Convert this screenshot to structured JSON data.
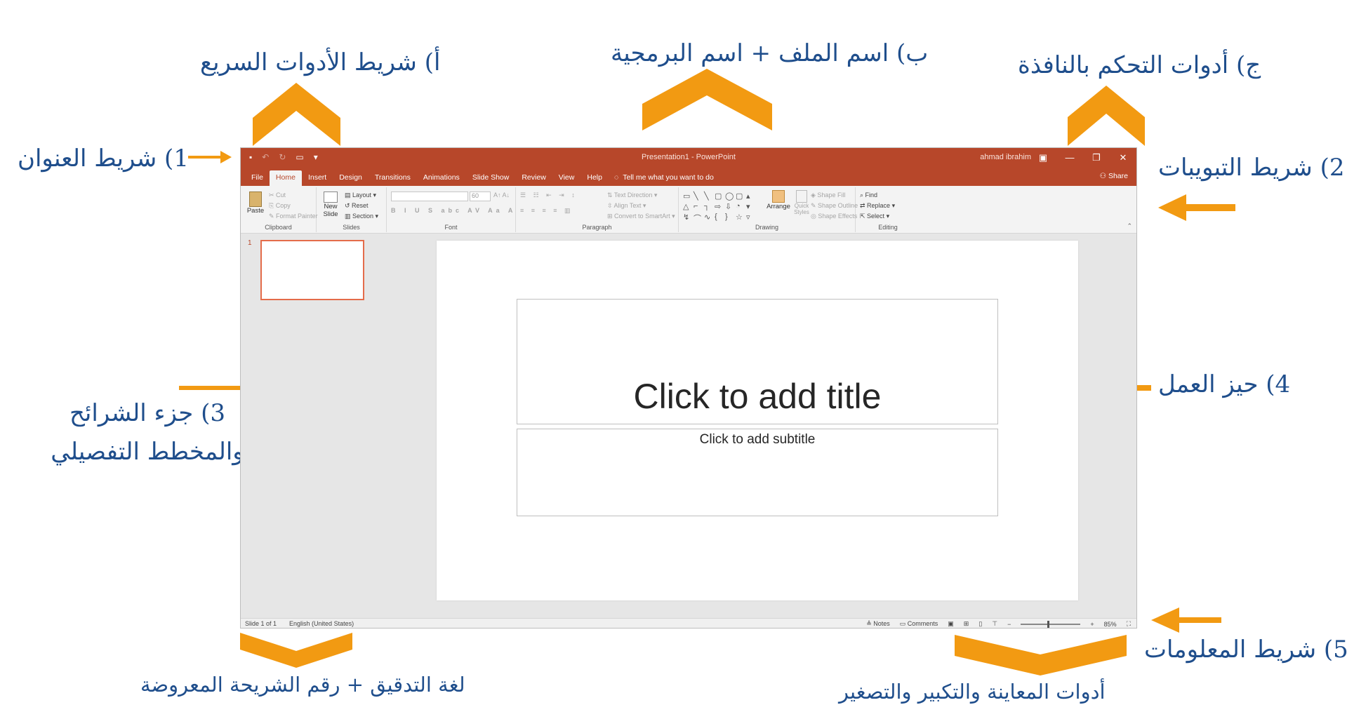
{
  "annotations": {
    "quick_access": "أ) شريط الأدوات السريع",
    "file_program_name": "ب) اسم الملف + اسم البرمجية",
    "window_controls": "ج) أدوات التحكم بالنافذة",
    "title_bar": "1) شريط العنوان",
    "tabs_bar": "2) شريط التبويبات",
    "slides_pane_line1": "3) جزء الشرائح",
    "slides_pane_line2": "والمخطط التفصيلي",
    "workspace": "4) حيز العمل",
    "status_bar": "5) شريط المعلومات",
    "language_slide_number": "لغة التدقيق + رقم الشريحة المعروضة",
    "view_zoom_tools": "أدوات المعاينة والتكبير والتصغير"
  },
  "colors": {
    "annotation_text": "#1f4e8c",
    "arrow": "#f29a12",
    "ppt_accent": "#b7472a"
  },
  "window": {
    "doc_title": "Presentation1 - PowerPoint",
    "user": "ahmad ibrahim",
    "controls": [
      "—",
      "❐",
      "✕"
    ]
  },
  "tabs": [
    "File",
    "Home",
    "Insert",
    "Design",
    "Transitions",
    "Animations",
    "Slide Show",
    "Review",
    "View",
    "Help"
  ],
  "tell_me": "Tell me what you want to do",
  "share": "Share",
  "ribbon": {
    "clipboard": {
      "paste": "Paste",
      "cut": "Cut",
      "copy": "Copy",
      "format_painter": "Format Painter",
      "name": "Clipboard"
    },
    "slides": {
      "new_slide": "New Slide",
      "layout": "Layout",
      "reset": "Reset",
      "section": "Section",
      "name": "Slides"
    },
    "font": {
      "size": "60",
      "name": "Font"
    },
    "paragraph": {
      "text_direction": "Text Direction",
      "align_text": "Align Text",
      "convert_smartart": "Convert to SmartArt",
      "name": "Paragraph"
    },
    "drawing": {
      "arrange": "Arrange",
      "quick_styles": "Quick Styles",
      "shape_fill": "Shape Fill",
      "shape_outline": "Shape Outline",
      "shape_effects": "Shape Effects",
      "name": "Drawing"
    },
    "editing": {
      "find": "Find",
      "replace": "Replace",
      "select": "Select",
      "name": "Editing"
    }
  },
  "thumb_number": "1",
  "slide": {
    "title_placeholder": "Click to add title",
    "subtitle_placeholder": "Click to add subtitle"
  },
  "status": {
    "slide_of": "Slide 1 of 1",
    "language": "English (United States)",
    "notes": "Notes",
    "comments": "Comments",
    "zoom_minus": "−",
    "zoom_plus": "+",
    "zoom": "85%"
  }
}
